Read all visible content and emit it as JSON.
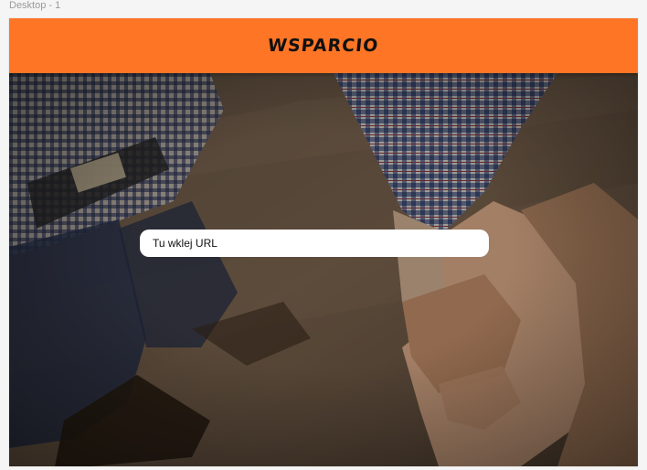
{
  "canvas": {
    "frame_label": "Desktop - 1"
  },
  "header": {
    "brand": "WSPARCIO",
    "color": "#ff7526"
  },
  "hero": {
    "image": "handshake-photo"
  },
  "url_input": {
    "placeholder": "Tu wklej URL"
  }
}
